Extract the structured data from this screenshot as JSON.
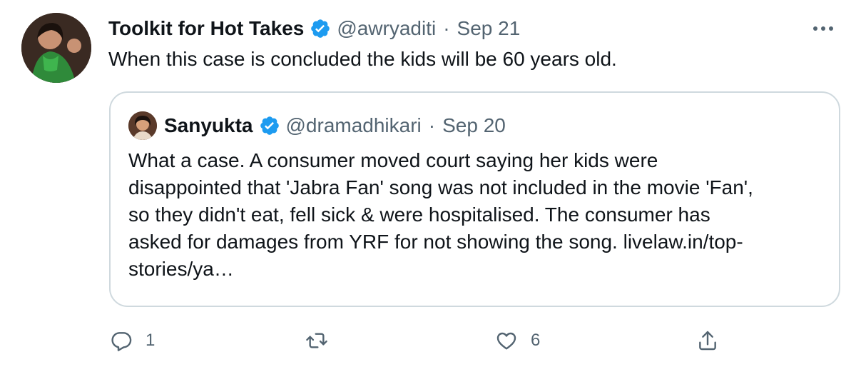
{
  "tweet": {
    "display_name": "Toolkit for Hot Takes",
    "handle": "@awryaditi",
    "separator": "·",
    "date": "Sep 21",
    "text": "When this case is concluded the kids will be 60 years old."
  },
  "quote": {
    "display_name": "Sanyukta",
    "handle": "@dramadhikari",
    "separator": "·",
    "date": "Sep 20",
    "lines": [
      "What a case. A consumer moved court saying her kids were",
      "disappointed that 'Jabra Fan' song was not included in the movie 'Fan',",
      "so they didn't eat, fell sick & were hospitalised. The consumer has",
      "asked for damages from YRF for not showing the song.  livelaw.in/top-",
      "stories/ya…"
    ]
  },
  "actions": {
    "reply_count": "1",
    "retweet_count": "",
    "like_count": "6"
  },
  "icons": {
    "verified": "verified-badge-icon",
    "more": "more-icon",
    "reply": "reply-icon",
    "retweet": "retweet-icon",
    "like": "heart-icon",
    "share": "share-icon"
  },
  "colors": {
    "text": "#0f1419",
    "secondary": "#536471",
    "verified": "#1d9bf0",
    "border": "#cfd9de"
  }
}
